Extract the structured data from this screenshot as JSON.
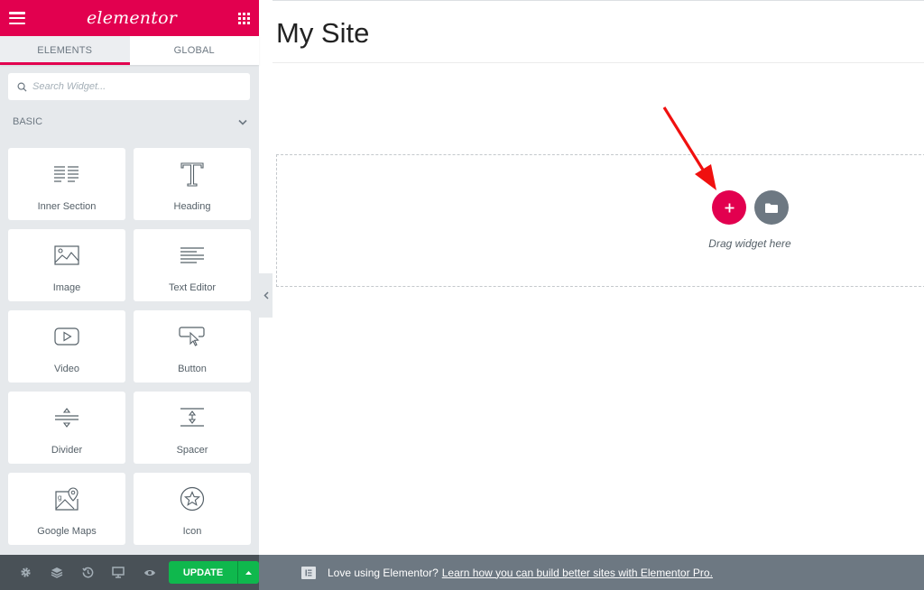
{
  "panel": {
    "logo": "elementor",
    "tabs": [
      {
        "label": "Elements",
        "active": true
      },
      {
        "label": "Global",
        "active": false
      }
    ],
    "search": {
      "placeholder": "Search Widget...",
      "value": ""
    },
    "category": {
      "title": "Basic",
      "icon": "chevron-down-icon"
    },
    "widgets": [
      {
        "label": "Inner Section",
        "icon": "inner-section-icon"
      },
      {
        "label": "Heading",
        "icon": "heading-icon"
      },
      {
        "label": "Image",
        "icon": "image-icon"
      },
      {
        "label": "Text Editor",
        "icon": "text-editor-icon"
      },
      {
        "label": "Video",
        "icon": "video-icon"
      },
      {
        "label": "Button",
        "icon": "button-icon"
      },
      {
        "label": "Divider",
        "icon": "divider-icon"
      },
      {
        "label": "Spacer",
        "icon": "spacer-icon"
      },
      {
        "label": "Google Maps",
        "icon": "google-maps-icon"
      },
      {
        "label": "Icon",
        "icon": "star-icon"
      }
    ],
    "footer": {
      "icons": [
        "settings-icon",
        "navigator-icon",
        "history-icon",
        "responsive-icon",
        "preview-icon"
      ],
      "update_label": "Update"
    }
  },
  "preview": {
    "site_title": "My Site",
    "drag_text": "Drag widget here"
  },
  "notice": {
    "text": "Love using Elementor?",
    "link": "Learn how you can build better sites with Elementor Pro."
  },
  "colors": {
    "brand": "#e2004f",
    "update": "#0fb84d",
    "panel_bg": "#e6e9ec",
    "footer_bg": "#495157",
    "notice_bg": "#6d7882"
  }
}
